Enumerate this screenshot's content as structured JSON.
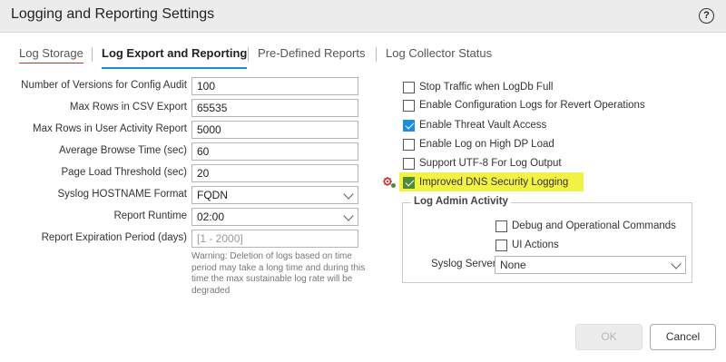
{
  "dialog": {
    "title": "Logging and Reporting Settings",
    "help_icon": "?"
  },
  "tabs": [
    {
      "label": "Log Storage"
    },
    {
      "label": "Log Export and Reporting"
    },
    {
      "label": "Pre-Defined Reports"
    },
    {
      "label": "Log Collector Status"
    }
  ],
  "left_fields": {
    "config_audit": {
      "label": "Number of Versions for Config Audit",
      "value": "100"
    },
    "csv_export": {
      "label": "Max Rows in CSV Export",
      "value": "65535"
    },
    "user_activity": {
      "label": "Max Rows in User Activity Report",
      "value": "5000"
    },
    "browse_time": {
      "label": "Average Browse Time (sec)",
      "value": "60"
    },
    "page_load": {
      "label": "Page Load Threshold (sec)",
      "value": "20"
    },
    "syslog_hostname": {
      "label": "Syslog HOSTNAME Format",
      "value": "FQDN"
    },
    "report_runtime": {
      "label": "Report Runtime",
      "value": "02:00"
    },
    "expiration": {
      "label": "Report Expiration Period (days)",
      "placeholder": "[1 - 2000]"
    }
  },
  "warning_text": "Warning: Deletion of logs based on time period may take a long time and during this time the max sustainable log rate will be degraded",
  "checkboxes": {
    "stop_traffic": {
      "label": "Stop Traffic when LogDb Full",
      "checked": false
    },
    "config_logs": {
      "label": "Enable Configuration Logs for Revert Operations",
      "checked": false
    },
    "threat_vault": {
      "label": "Enable Threat Vault Access",
      "checked": true
    },
    "high_dp": {
      "label": "Enable Log on High DP Load",
      "checked": false
    },
    "utf8": {
      "label": "Support UTF-8 For Log Output",
      "checked": false
    },
    "dns_security": {
      "label": "Improved DNS Security Logging",
      "checked": true
    }
  },
  "log_admin": {
    "title": "Log Admin Activity",
    "debug": {
      "label": "Debug and Operational Commands",
      "checked": false
    },
    "ui_actions": {
      "label": "UI Actions",
      "checked": false
    },
    "syslog_server": {
      "label": "Syslog Server",
      "value": "None"
    }
  },
  "buttons": {
    "ok": "OK",
    "cancel": "Cancel"
  },
  "colors": {
    "accent": "#1d8fd6",
    "highlight": "#f2f244",
    "active_underline_first": "#d32f2f"
  }
}
